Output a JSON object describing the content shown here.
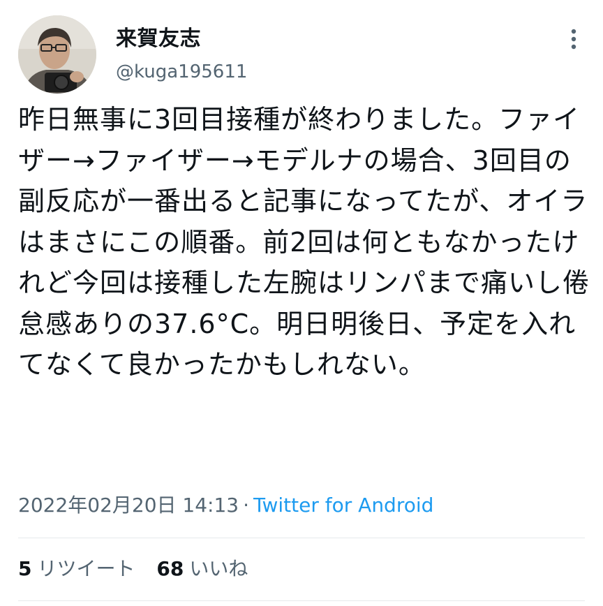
{
  "tweet": {
    "author": {
      "display_name": "来賀友志",
      "handle": "@kuga195611"
    },
    "text": "昨日無事に3回目接種が終わりました。ファイザー→ファイザー→モデルナの場合、3回目の副反応が一番出ると記事になってたが、オイラはまさにこの順番。前2回は何ともなかったけれど今回は接種した左腕はリンパまで痛いし倦怠感ありの37.6°C。明日明後日、予定を入れてなくて良かったかもしれない。",
    "timestamp": "2022年02月20日 14:13",
    "separator": "·",
    "source": "Twitter for Android",
    "stats": {
      "retweets_count": "5",
      "retweets_label": "リツイート",
      "likes_count": "68",
      "likes_label": "いいね"
    }
  },
  "icons": {
    "more": "more-vertical-icon",
    "avatar": "profile-photo"
  },
  "colors": {
    "text": "#0f1419",
    "secondary": "#536471",
    "link": "#1d9bf0",
    "divider": "#e6e9eb"
  }
}
